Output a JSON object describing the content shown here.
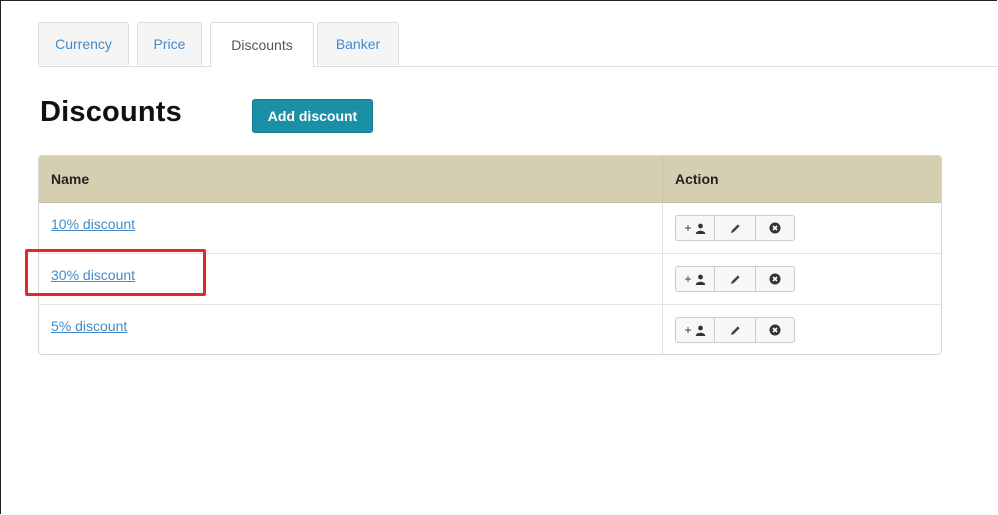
{
  "tabs": [
    {
      "label": "Currency",
      "active": false
    },
    {
      "label": "Price",
      "active": false
    },
    {
      "label": "Discounts",
      "active": true
    },
    {
      "label": "Banker",
      "active": false
    }
  ],
  "page_title": "Discounts",
  "add_button_label": "Add discount",
  "table": {
    "headers": {
      "name": "Name",
      "action": "Action"
    },
    "rows": [
      {
        "name": "10% discount"
      },
      {
        "name": "30% discount"
      },
      {
        "name": "5% discount"
      }
    ],
    "action_buttons": [
      {
        "icon": "add-user-icon",
        "plus": "+"
      },
      {
        "icon": "pencil-icon"
      },
      {
        "icon": "remove-circle-icon"
      }
    ]
  },
  "highlight_color": "#e8252a",
  "accent_color": "#1a8fa6",
  "header_bg": "#d5cfb2"
}
